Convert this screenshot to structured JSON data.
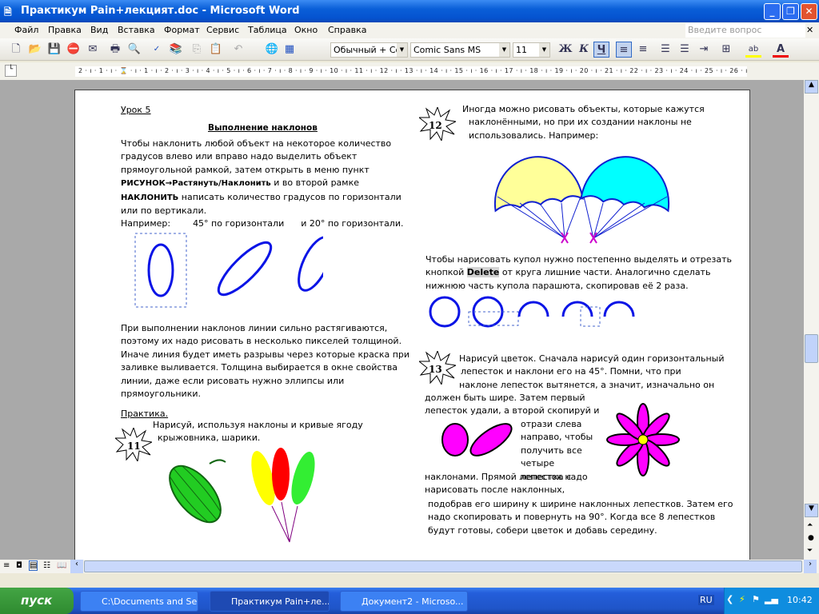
{
  "window": {
    "title": "Практикум  Pain+лекцият.doc - Microsoft Word",
    "minimize": "_",
    "restore": "❐",
    "close": "✕"
  },
  "menu": {
    "items": [
      "Файл",
      "Правка",
      "Вид",
      "Вставка",
      "Формат",
      "Сервис",
      "Таблица",
      "Окно",
      "Справка"
    ],
    "help_placeholder": "Введите вопрос"
  },
  "toolbar": {
    "style": "Обычный + Com",
    "font": "Comic Sans MS",
    "size": "11",
    "bold": "Ж",
    "italic": "К",
    "underline": "Ч"
  },
  "ruler": {
    "ticks": "2 · ı · 1 · ı · ⌛ · ı · 1 · ı · 2 · ı · 3 · ı · 4 · ı · 5 · ı · 6 · ı · 7 · ı · 8 · ı · 9 · ı · 10 · ı · 11 · ı · 12 · ı · 13 · ı · 14 · ı · 15 · ı · 16 · ı · 17 · ı · 18 · ı · 19 · ı · 20 · ı · 21 · ı · 22 · ı · 23 · ı · 24 · ı · 25 · ı · 26 · ı · 27 · ı"
  },
  "doc": {
    "lesson": "Урок 5",
    "heading": "Выполнение  наклонов",
    "p1": [
      "Чтобы наклонить любой объект на некоторое количество",
      "градусов влево или вправо надо выделить объект",
      "прямоугольной рамкой, затем открыть в меню пункт"
    ],
    "p1_bold1": "РИСУНОК→Растянуть/Наклонить",
    "p1_rest1": " и во второй рамке",
    "p1_bold2": "НАКЛОНИТЬ",
    "p1_rest2": " написать количество градусов по горизонтали",
    "p1_end": "или по вертикали.",
    "example": "Например:        45° по горизонтали      и 20° по горизонтали.",
    "p2": [
      "При выполнении наклонов линии сильно растягиваются,",
      "поэтому их надо рисовать в несколько пикселей толщиной.",
      "Иначе линия будет иметь разрывы через которые краска при",
      "заливке выливается. Толщина выбирается в окне свойства",
      "линии, даже если рисовать нужно эллипсы или",
      "прямоугольники."
    ],
    "practice": "Практика.",
    "task11_num": "11",
    "task11": [
      "Нарисуй, используя наклоны и кривые ягоду",
      "крыжовника, шарики."
    ],
    "task12_num": "12",
    "task12": [
      "Иногда можно рисовать объекты, которые кажутся",
      "наклонёнными, но при их создании наклоны не",
      "использовались. Например:"
    ],
    "p3_line1": "Чтобы нарисовать купол нужно постепенно выделять и отрезать",
    "p3_pre": "кнопкой ",
    "p3_key": "Delete",
    "p3_post": " от круга лишние части. Аналогично сделать",
    "p3_line3": "нижнюю часть купола парашюта, скопировав её 2 раза.",
    "task13_num": "13",
    "task13": [
      "Нарисуй цветок. Сначала нарисуй один горизонтальный",
      "лепесток и наклони его на 45°. Помни, что при",
      "наклоне лепесток вытянется, а значит, изначально он"
    ],
    "task13_b": [
      "должен быть шире. Затем первый",
      "лепесток удали, а второй скопируй и"
    ],
    "task13_c": [
      "отрази слева",
      "направо, чтобы",
      "получить все",
      "четыре",
      "лепестка с"
    ],
    "task13_d": [
      "наклонами. Прямой лепесток надо",
      "нарисовать после наклонных,"
    ],
    "task13_e": [
      "подобрав его ширину к ширине наклонных лепестков. Затем его",
      "надо скопировать и повернуть на 90°. Когда все 8 лепестков",
      "будут готовы, собери цветок и добавь середину."
    ]
  },
  "colors": {
    "ellipse": "#0a14e6",
    "petal": "#ff00ff",
    "center": "#ffff00",
    "canopy_left": "#ffff99",
    "canopy_right": "#00ffff",
    "berry": "#22cc22"
  },
  "taskbar": {
    "start": "пуск",
    "tasks": [
      "C:\\Documents and Se...",
      "Практикум  Pain+ле...",
      "Документ2 - Microso..."
    ],
    "lang": "RU",
    "clock": "10:42"
  }
}
